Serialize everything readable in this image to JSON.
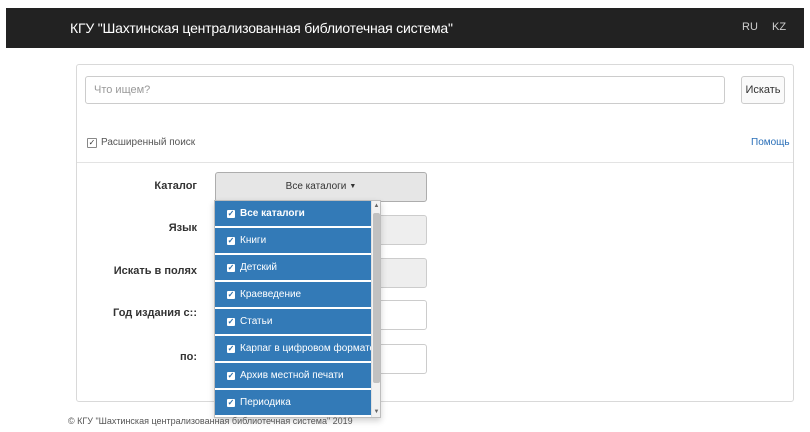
{
  "navbar": {
    "brand": "КГУ \"Шахтинская централизованная библиотечная система\"",
    "lang_ru": "RU",
    "lang_kz": "KZ"
  },
  "search": {
    "placeholder": "Что ищем?",
    "value": "",
    "button_label": "Искать"
  },
  "advanced": {
    "checkbox_checked": true,
    "label": "Расширенный поиск",
    "help_label": "Помощь"
  },
  "form": {
    "catalog_label": "Каталог",
    "catalog_value": "Все каталоги",
    "language_label": "Язык",
    "fields_label": "Искать в полях",
    "year_from_label": "Год издания с::",
    "year_to_label": "по:"
  },
  "dropdown": {
    "items": [
      {
        "label": "Все каталоги",
        "checked": true
      },
      {
        "label": "Книги",
        "checked": true
      },
      {
        "label": "Детский",
        "checked": true
      },
      {
        "label": "Краеведение",
        "checked": true
      },
      {
        "label": "Статьи",
        "checked": true
      },
      {
        "label": "Карпаг в цифровом формате",
        "checked": true
      },
      {
        "label": "Архив местной печати",
        "checked": true
      },
      {
        "label": "Периодика",
        "checked": true
      }
    ]
  },
  "footer": {
    "text": "© КГУ \"Шахтинская централизованная библиотечная система\" 2019"
  },
  "colors": {
    "navbar_bg": "#222222",
    "dropdown_item_bg": "#337ab7",
    "link": "#2a6fb8"
  }
}
